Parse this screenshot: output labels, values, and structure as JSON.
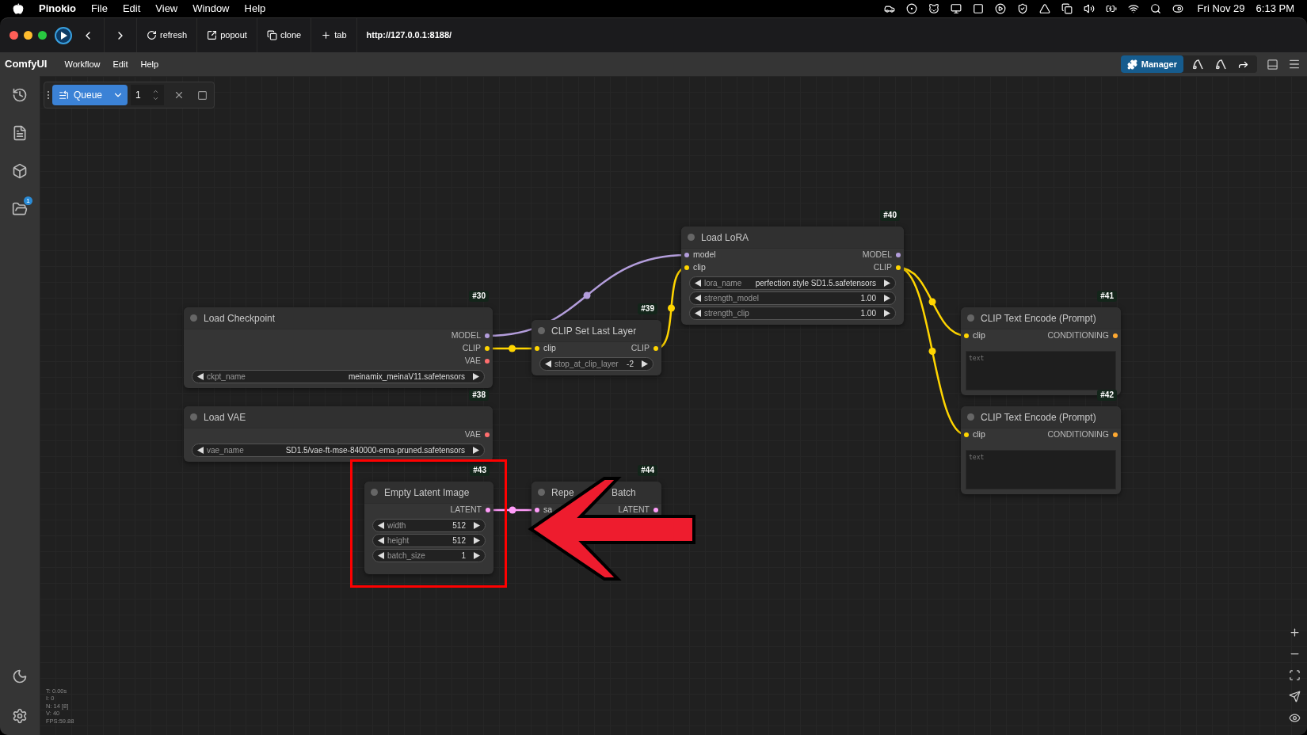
{
  "menu_bar": {
    "app": "Pinokio",
    "items": [
      "File",
      "Edit",
      "View",
      "Window",
      "Help"
    ],
    "date": "Fri Nov 29",
    "time": "6:13 PM"
  },
  "browser_toolbar": {
    "buttons": [
      {
        "kind": "refresh",
        "label": "refresh"
      },
      {
        "kind": "popout",
        "label": "popout"
      },
      {
        "kind": "clone",
        "label": "clone"
      },
      {
        "kind": "tab",
        "label": "tab"
      }
    ],
    "url": "http://127.0.0.1:8188/"
  },
  "comfy_menu": {
    "brand": "ComfyUI",
    "items": [
      "Workflow",
      "Edit",
      "Help"
    ],
    "manager_button": "Manager"
  },
  "queue": {
    "label": "Queue",
    "count": "1"
  },
  "sidebar": {
    "badge": "1"
  },
  "nodes": [
    {
      "id": "#30",
      "title": "Load Checkpoint",
      "outputs": [
        {
          "label": "MODEL",
          "color": "#b39ddb"
        },
        {
          "label": "CLIP",
          "color": "#ffd500"
        },
        {
          "label": "VAE",
          "color": "#ff6e6e"
        }
      ],
      "widgets": [
        {
          "name": "ckpt_name",
          "value": "meinamix_meinaV11.safetensors"
        }
      ]
    },
    {
      "id": "#38",
      "title": "Load VAE",
      "outputs": [
        {
          "label": "VAE",
          "color": "#ff6e6e"
        }
      ],
      "widgets": [
        {
          "name": "vae_name",
          "value": "SD1.5/vae-ft-mse-840000-ema-pruned.safetensors"
        }
      ]
    },
    {
      "id": "#39",
      "title": "CLIP Set Last Layer",
      "inputs": [
        {
          "label": "clip",
          "color": "#ffd500"
        }
      ],
      "outputs": [
        {
          "label": "CLIP",
          "color": "#ffd500"
        }
      ],
      "widgets": [
        {
          "name": "stop_at_clip_layer",
          "value": "-2"
        }
      ]
    },
    {
      "id": "#40",
      "title": "Load LoRA",
      "inputs": [
        {
          "label": "model",
          "color": "#b39ddb"
        },
        {
          "label": "clip",
          "color": "#ffd500"
        }
      ],
      "outputs": [
        {
          "label": "MODEL",
          "color": "#b39ddb"
        },
        {
          "label": "CLIP",
          "color": "#ffd500"
        }
      ],
      "widgets": [
        {
          "name": "lora_name",
          "value": "perfection style SD1.5.safetensors"
        },
        {
          "name": "strength_model",
          "value": "1.00"
        },
        {
          "name": "strength_clip",
          "value": "1.00"
        }
      ]
    },
    {
      "id": "#41",
      "title": "CLIP Text Encode (Prompt)",
      "inputs": [
        {
          "label": "clip",
          "color": "#ffd500"
        }
      ],
      "outputs": [
        {
          "label": "CONDITIONING",
          "color": "#ffa931"
        }
      ],
      "textarea": {
        "placeholder": "text"
      }
    },
    {
      "id": "#42",
      "title": "CLIP Text Encode (Prompt)",
      "inputs": [
        {
          "label": "clip",
          "color": "#ffd500"
        }
      ],
      "outputs": [
        {
          "label": "CONDITIONING",
          "color": "#ffa931"
        }
      ],
      "textarea": {
        "placeholder": "text"
      }
    },
    {
      "id": "#43",
      "title": "Empty Latent Image",
      "outputs": [
        {
          "label": "LATENT",
          "color": "#ff9cf9"
        }
      ],
      "widgets": [
        {
          "name": "width",
          "value": "512"
        },
        {
          "name": "height",
          "value": "512"
        },
        {
          "name": "batch_size",
          "value": "1"
        }
      ]
    },
    {
      "id": "#44",
      "title": "Repe",
      "title_end": "Batch",
      "inputs": [
        {
          "label": "sa",
          "color": "#ff9cf9"
        }
      ],
      "outputs": [
        {
          "label": "LATENT",
          "color": "#ff9cf9"
        }
      ]
    }
  ],
  "stats": [
    "T: 0.00s",
    "I: 0",
    "N: 14 [8]",
    "V: 40",
    "FPS:59.88"
  ]
}
